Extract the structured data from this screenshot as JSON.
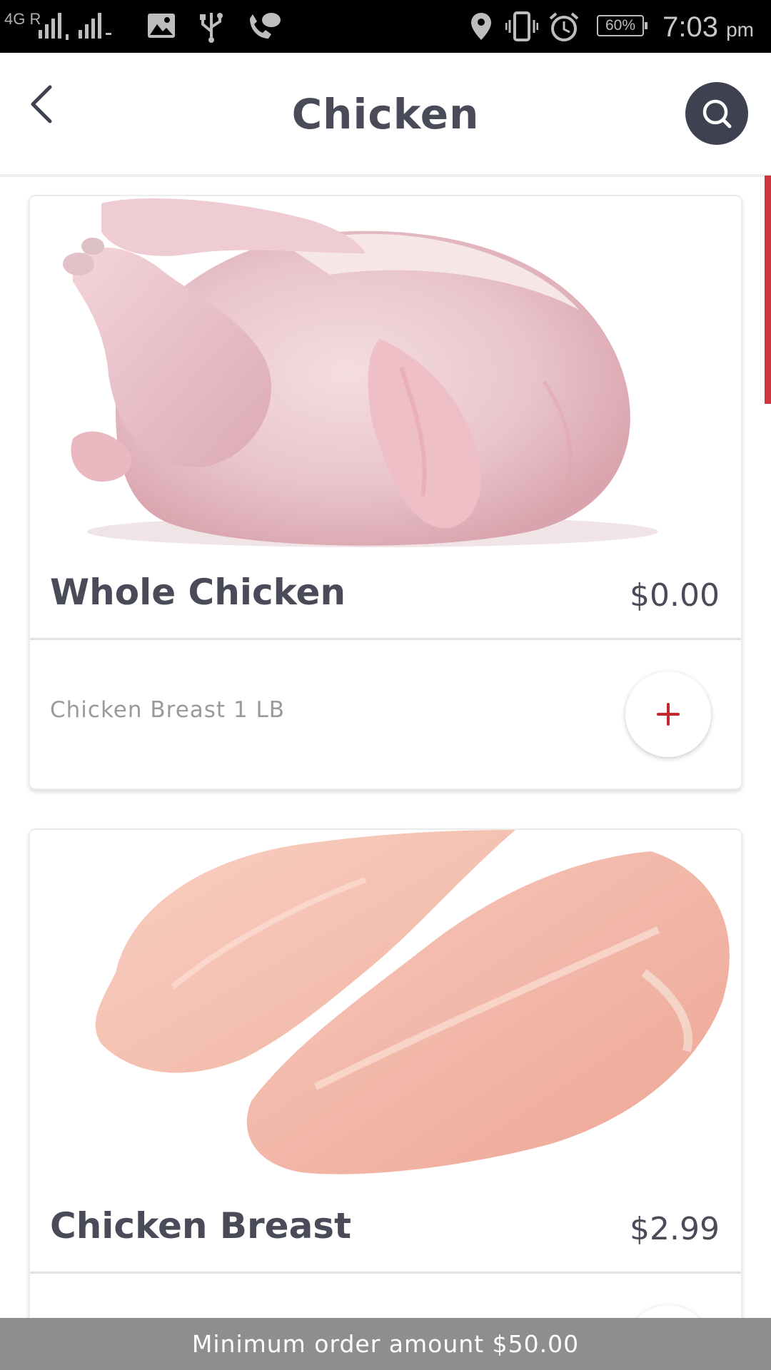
{
  "status_bar": {
    "network": "4G R",
    "battery": "60%",
    "time": "7:03",
    "ampm": "pm",
    "icons": [
      "signal-icon",
      "gallery-icon",
      "usb-icon",
      "call-icon",
      "location-icon",
      "vibrate-icon",
      "alarm-icon",
      "battery-icon"
    ]
  },
  "header": {
    "title": "Chicken",
    "back_icon": "chevron-left-icon",
    "search_icon": "search-icon"
  },
  "colors": {
    "accent": "#d0343c",
    "text": "#4a4b58",
    "search_bg": "#3e4150",
    "bottom_bar": "#8e8e8e"
  },
  "products": [
    {
      "name": "Whole Chicken",
      "price": "$0.00",
      "description": "Chicken Breast 1 LB",
      "add_icon": "plus-icon"
    },
    {
      "name": "Chicken Breast",
      "price": "$2.99",
      "add_icon": "plus-icon"
    }
  ],
  "footer": {
    "min_order": "Minimum order amount $50.00"
  }
}
